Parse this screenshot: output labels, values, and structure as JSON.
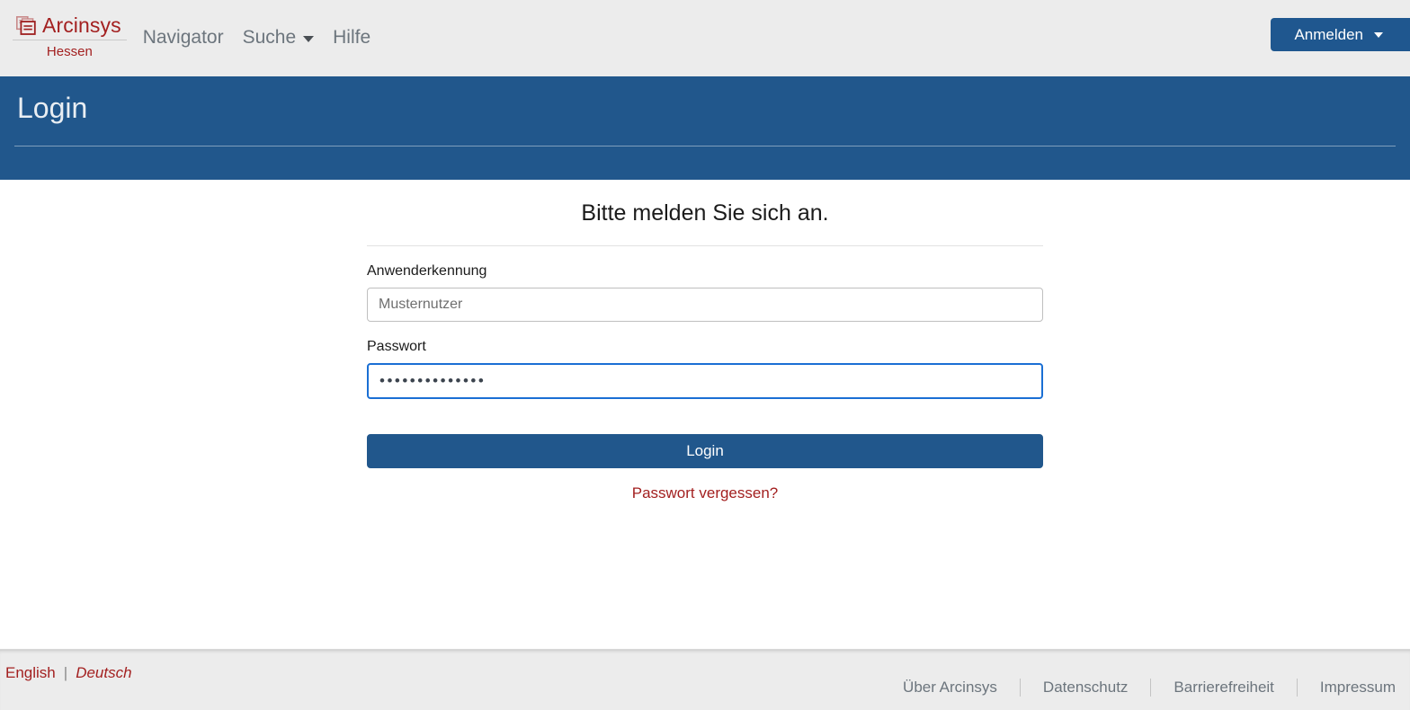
{
  "header": {
    "brand": {
      "name": "Arcinsys",
      "region": "Hessen",
      "icon": "documents-icon"
    },
    "nav": [
      {
        "label": "Navigator",
        "has_caret": false
      },
      {
        "label": "Suche",
        "has_caret": true
      },
      {
        "label": "Hilfe",
        "has_caret": false
      }
    ],
    "login_button": {
      "label": "Anmelden",
      "caret": true
    }
  },
  "banner": {
    "title": "Login"
  },
  "form": {
    "heading": "Bitte melden Sie sich an.",
    "username": {
      "label": "Anwenderkennung",
      "value": "",
      "placeholder": "Musternutzer"
    },
    "password": {
      "label": "Passwort",
      "value": "••••••••••••••",
      "placeholder": ""
    },
    "submit_label": "Login",
    "forgot_label": "Passwort vergessen?"
  },
  "footer": {
    "languages": {
      "other": "English",
      "separator": "|",
      "current": "Deutsch"
    },
    "links": [
      "Über Arcinsys",
      "Datenschutz",
      "Barrierefreiheit",
      "Impressum"
    ]
  },
  "colors": {
    "brand_red": "#a32020",
    "primary_blue": "#21578c",
    "focus_blue": "#1a6fd4",
    "bar_grey": "#ececec",
    "muted_text": "#6c757d"
  }
}
